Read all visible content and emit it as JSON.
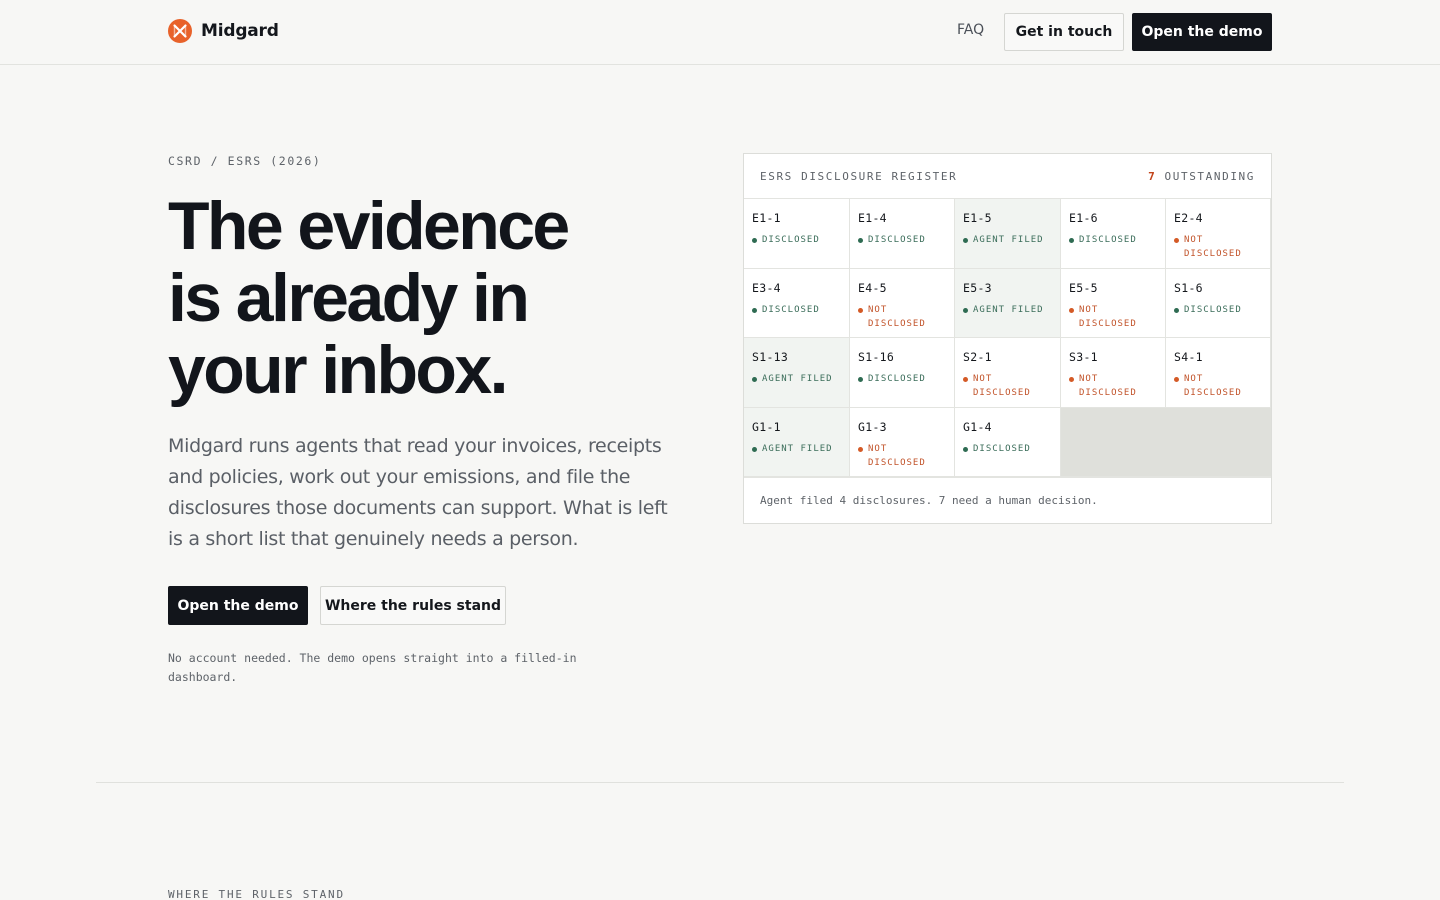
{
  "header": {
    "brand": "Midgard",
    "nav_faq": "FAQ",
    "contact_label": "Get in touch",
    "demo_label": "Open the demo"
  },
  "hero": {
    "eyebrow": "CSRD / ESRS (2026)",
    "headline_lines": [
      "The evidence",
      "is already in",
      "your inbox."
    ],
    "lede": "Midgard runs agents that read your invoices, receipts and policies, work out your emissions, and file the disclosures those documents can support. What is left is a short list that genuinely needs a person.",
    "cta_primary": "Open the demo",
    "cta_secondary": "Where the rules stand",
    "note": "No account needed. The demo opens straight into a filled-in dashboard."
  },
  "register": {
    "title": "ESRS DISCLOSURE REGISTER",
    "outstanding_count": "7",
    "outstanding_label": "OUTSTANDING",
    "cells": [
      {
        "code": "E1-1",
        "status": "DISCLOSED",
        "kind": "ok"
      },
      {
        "code": "E1-4",
        "status": "DISCLOSED",
        "kind": "ok"
      },
      {
        "code": "E1-5",
        "status": "AGENT FILED",
        "kind": "agent"
      },
      {
        "code": "E1-6",
        "status": "DISCLOSED",
        "kind": "ok"
      },
      {
        "code": "E2-4",
        "status": "NOT DISCLOSED",
        "kind": "no"
      },
      {
        "code": "E3-4",
        "status": "DISCLOSED",
        "kind": "ok"
      },
      {
        "code": "E4-5",
        "status": "NOT DISCLOSED",
        "kind": "no"
      },
      {
        "code": "E5-3",
        "status": "AGENT FILED",
        "kind": "agent"
      },
      {
        "code": "E5-5",
        "status": "NOT DISCLOSED",
        "kind": "no"
      },
      {
        "code": "S1-6",
        "status": "DISCLOSED",
        "kind": "ok"
      },
      {
        "code": "S1-13",
        "status": "AGENT FILED",
        "kind": "agent"
      },
      {
        "code": "S1-16",
        "status": "DISCLOSED",
        "kind": "ok"
      },
      {
        "code": "S2-1",
        "status": "NOT DISCLOSED",
        "kind": "no"
      },
      {
        "code": "S3-1",
        "status": "NOT DISCLOSED",
        "kind": "no"
      },
      {
        "code": "S4-1",
        "status": "NOT DISCLOSED",
        "kind": "no"
      },
      {
        "code": "G1-1",
        "status": "AGENT FILED",
        "kind": "agent"
      },
      {
        "code": "G1-3",
        "status": "NOT DISCLOSED",
        "kind": "no"
      },
      {
        "code": "G1-4",
        "status": "DISCLOSED",
        "kind": "ok"
      }
    ],
    "footer": "Agent filed 4 disclosures. 7 need a human decision."
  },
  "next_section": {
    "eyebrow": "WHERE THE RULES STAND"
  },
  "colors": {
    "accent_dark": "#12151b",
    "status_ok": "#2e6b52",
    "status_missing": "#d45a26",
    "logo": "#e8622a"
  }
}
